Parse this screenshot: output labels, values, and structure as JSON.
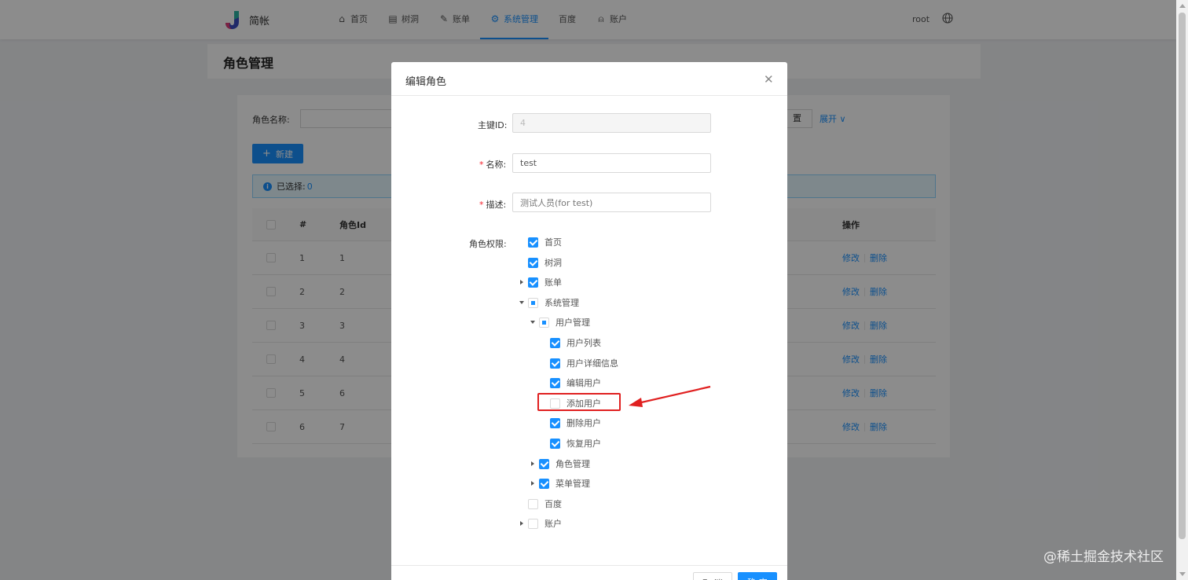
{
  "header": {
    "brand": "简帐",
    "nav": [
      {
        "label": "首页",
        "icon": "home-icon"
      },
      {
        "label": "树洞",
        "icon": "book-icon"
      },
      {
        "label": "账单",
        "icon": "edit-icon"
      },
      {
        "label": "系统管理",
        "icon": "gear-icon",
        "active": true
      },
      {
        "label": "百度",
        "icon": ""
      },
      {
        "label": "账户",
        "icon": "user-icon"
      }
    ],
    "user": "root"
  },
  "page": {
    "title": "角色管理",
    "search_label": "角色名称:",
    "reset_label": "置",
    "expand_label": "展开",
    "new_button": "新建",
    "selected_label": "已选择:",
    "selected_count": "0",
    "table": {
      "headers": [
        "#",
        "角色Id",
        "操作"
      ],
      "rows": [
        {
          "index": "1",
          "id": "1"
        },
        {
          "index": "2",
          "id": "2"
        },
        {
          "index": "3",
          "id": "3"
        },
        {
          "index": "4",
          "id": "4"
        },
        {
          "index": "5",
          "id": "6"
        },
        {
          "index": "6",
          "id": "7"
        }
      ],
      "edit_label": "修改",
      "delete_label": "删除"
    }
  },
  "modal": {
    "title": "编辑角色",
    "fields": {
      "id_label": "主键ID:",
      "id_value": "4",
      "name_label": "名称:",
      "name_value": "test",
      "desc_label": "描述:",
      "desc_value": "测试人员(for test)",
      "perm_label": "角色权限:"
    },
    "tree": [
      {
        "label": "首页",
        "state": "checked",
        "switch": "none",
        "level": 0
      },
      {
        "label": "树洞",
        "state": "checked",
        "switch": "none",
        "level": 0
      },
      {
        "label": "账单",
        "state": "checked",
        "switch": "collapsed",
        "level": 0
      },
      {
        "label": "系统管理",
        "state": "half",
        "switch": "expanded",
        "level": 0
      },
      {
        "label": "用户管理",
        "state": "half",
        "switch": "expanded",
        "level": 1
      },
      {
        "label": "用户列表",
        "state": "checked",
        "switch": "none",
        "level": 2
      },
      {
        "label": "用户详细信息",
        "state": "checked",
        "switch": "none",
        "level": 2
      },
      {
        "label": "编辑用户",
        "state": "checked",
        "switch": "none",
        "level": 2
      },
      {
        "label": "添加用户",
        "state": "unchecked",
        "switch": "none",
        "level": 2
      },
      {
        "label": "删除用户",
        "state": "checked",
        "switch": "none",
        "level": 2
      },
      {
        "label": "恢复用户",
        "state": "checked",
        "switch": "none",
        "level": 2
      },
      {
        "label": "角色管理",
        "state": "checked",
        "switch": "collapsed",
        "level": 1
      },
      {
        "label": "菜单管理",
        "state": "checked",
        "switch": "collapsed",
        "level": 1
      },
      {
        "label": "百度",
        "state": "unchecked",
        "switch": "none",
        "level": 0
      },
      {
        "label": "账户",
        "state": "unchecked",
        "switch": "collapsed",
        "level": 0
      }
    ],
    "cancel_label": "取 消",
    "ok_label": "确 定"
  },
  "annotation_color": "#e02020",
  "watermark": "@稀土掘金技术社区"
}
